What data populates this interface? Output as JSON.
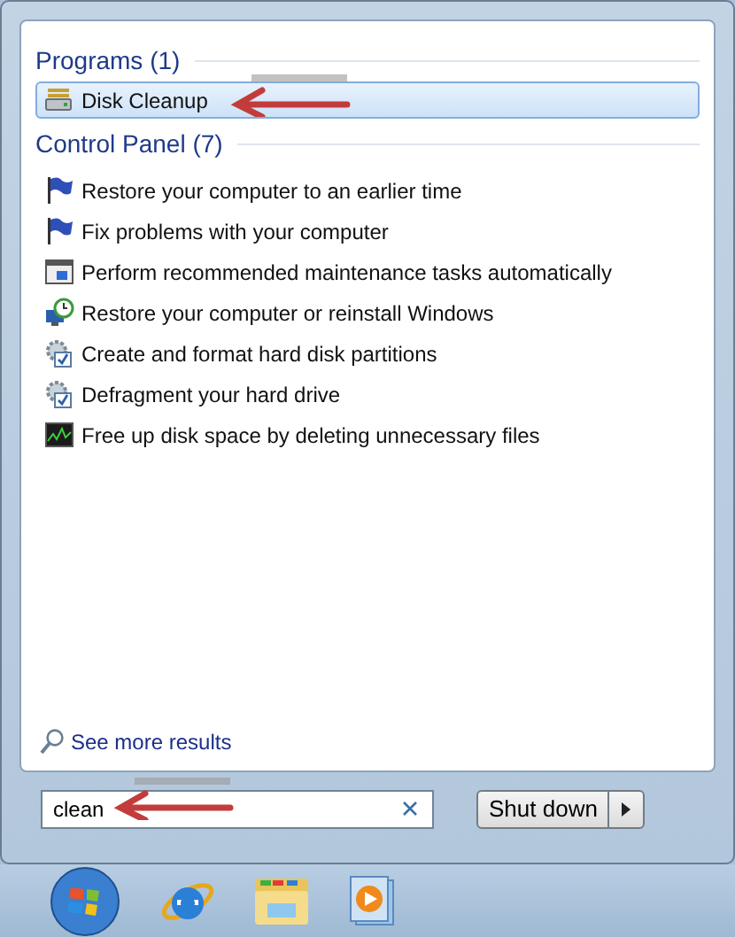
{
  "programs": {
    "heading": "Programs (1)",
    "items": [
      {
        "label": "Disk Cleanup",
        "kind": "drive",
        "selected": true
      }
    ]
  },
  "control_panel": {
    "heading": "Control Panel (7)",
    "items": [
      {
        "label": "Restore your computer to an earlier time",
        "kind": "flag",
        "selected": false
      },
      {
        "label": "Fix problems with your computer",
        "kind": "flag",
        "selected": false
      },
      {
        "label": "Perform recommended maintenance tasks automatically",
        "kind": "window",
        "selected": false
      },
      {
        "label": "Restore your computer or reinstall Windows",
        "kind": "restore",
        "selected": false
      },
      {
        "label": "Create and format hard disk partitions",
        "kind": "gear",
        "selected": false
      },
      {
        "label": "Defragment your hard drive",
        "kind": "gear",
        "selected": false
      },
      {
        "label": "Free up disk space by deleting unnecessary files",
        "kind": "chart",
        "selected": false
      }
    ]
  },
  "see_more": "See more results",
  "search": {
    "value": "clean"
  },
  "shutdown": {
    "label": "Shut down"
  }
}
